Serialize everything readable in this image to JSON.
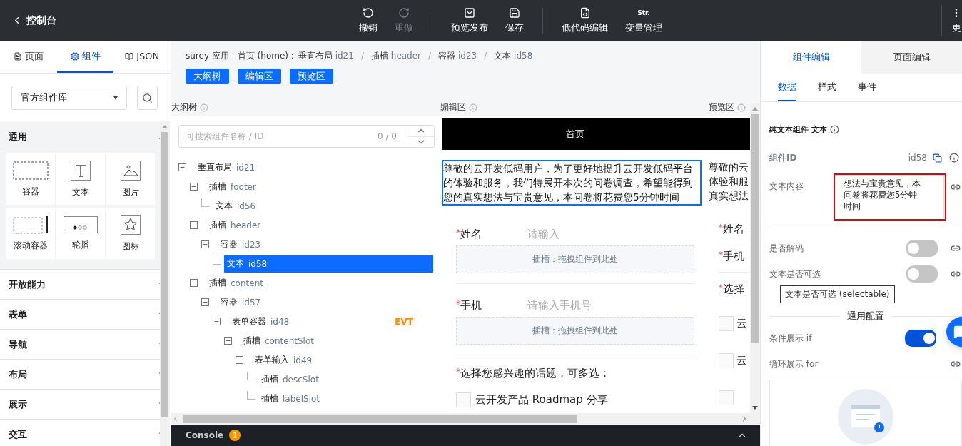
{
  "topbar": {
    "back": "控制台",
    "groups": [
      {
        "buttons": [
          {
            "label": "撤销",
            "kind": "undo",
            "disabled": false
          },
          {
            "label": "重做",
            "kind": "redo",
            "disabled": true
          }
        ]
      },
      {
        "buttons": [
          {
            "label": "预览发布",
            "kind": "preview",
            "disabled": false
          },
          {
            "label": "保存",
            "kind": "save",
            "disabled": false
          }
        ]
      },
      {
        "buttons": [
          {
            "label": "低代码编辑",
            "kind": "code",
            "disabled": false
          },
          {
            "label": "变量管理",
            "kind": "text",
            "icon_text": "Str.",
            "disabled": false
          }
        ]
      }
    ],
    "more": {
      "label": "更"
    }
  },
  "left_panel": {
    "tabs": [
      {
        "label": "页面",
        "kind": "page",
        "selected": false
      },
      {
        "label": "组件",
        "kind": "component",
        "selected": true
      },
      {
        "label": "JSON",
        "kind": "json",
        "selected": false
      }
    ],
    "library_select": "官方组件库",
    "categories": [
      {
        "label": "通用",
        "expanded": true,
        "items": [
          {
            "label": "容器",
            "kind": "container"
          },
          {
            "label": "文本",
            "kind": "text"
          },
          {
            "label": "图片",
            "kind": "image"
          },
          {
            "label": "滚动容器",
            "kind": "scroll"
          },
          {
            "label": "轮播",
            "kind": "carousel"
          },
          {
            "label": "图标",
            "kind": "icon"
          }
        ]
      },
      {
        "label": "开放能力",
        "expanded": false
      },
      {
        "label": "表单",
        "expanded": false
      },
      {
        "label": "导航",
        "expanded": false
      },
      {
        "label": "布局",
        "expanded": false
      },
      {
        "label": "展示",
        "expanded": false
      },
      {
        "label": "交互",
        "expanded": false
      }
    ]
  },
  "breadcrumb": {
    "app": "surey 应用 - 首页 (home) :",
    "segments": [
      {
        "name": "垂直布局",
        "id": "id21"
      },
      {
        "sep": "/",
        "name": "插槽",
        "id": "header"
      },
      {
        "sep": "/",
        "name": "容器",
        "id": "id23"
      },
      {
        "sep": "/",
        "name": "文本",
        "id": "id58"
      }
    ]
  },
  "view_buttons": [
    "大纲树",
    "编辑区",
    "预览区"
  ],
  "outline": {
    "title": "大纲树",
    "search_placeholder": "可搜索组件名称 / ID",
    "count": "0 / 0",
    "tree": [
      {
        "name": "垂直布局",
        "id": "id21",
        "expanded": true,
        "selected": false,
        "children": [
          {
            "name": "插槽",
            "id": "footer",
            "expanded": true,
            "selected": false,
            "children": [
              {
                "name": "文本",
                "id": "id56",
                "selected": false
              }
            ]
          },
          {
            "name": "插槽",
            "id": "header",
            "expanded": true,
            "selected": false,
            "children": [
              {
                "name": "容器",
                "id": "id23",
                "expanded": true,
                "selected": false,
                "children": [
                  {
                    "name": "文本",
                    "id": "id58",
                    "selected": true
                  }
                ]
              }
            ]
          },
          {
            "name": "插槽",
            "id": "content",
            "expanded": true,
            "selected": false,
            "children": [
              {
                "name": "容器",
                "id": "id57",
                "expanded": true,
                "selected": false,
                "children": [
                  {
                    "name": "表单容器",
                    "id": "id48",
                    "badge": "EVT",
                    "expanded": true,
                    "selected": false,
                    "children": [
                      {
                        "name": "插槽",
                        "id": "contentSlot",
                        "expanded": true,
                        "selected": false,
                        "children": [
                          {
                            "name": "表单输入",
                            "id": "id49",
                            "expanded": true,
                            "selected": false,
                            "children": [
                              {
                                "name": "插槽",
                                "id": "descSlot",
                                "selected": false
                              },
                              {
                                "name": "插槽",
                                "id": "labelSlot",
                                "selected": false
                              }
                            ]
                          }
                        ]
                      }
                    ]
                  }
                ]
              }
            ]
          }
        ]
      }
    ]
  },
  "editor": {
    "title": "编辑区",
    "header": "首页",
    "intro": "尊敬的云开发低码用户，为了更好地提升云开发低码平台的体验和服务，我们特展开本次的问卷调查，希望能得到您的真实想法与宝贵意见，本问卷将花费您5分钟时间",
    "fields": [
      {
        "mark": "*",
        "label": "姓名",
        "placeholder": "请输入",
        "slot": "插槽：拖拽组件到此处"
      },
      {
        "mark": "*",
        "label": "手机",
        "placeholder": "请输入手机号",
        "slot": "插槽：拖拽组件到此处"
      }
    ],
    "question": {
      "mark": "*",
      "label": "选择您感兴趣的话题，可多选：",
      "options": [
        {
          "label": "云开发产品 Roadmap 分享",
          "checked": false
        }
      ]
    }
  },
  "preview": {
    "title": "预览区",
    "intro_lines": [
      "尊敬的云",
      "体验和服",
      "真实想法"
    ],
    "fields": [
      {
        "mark": "*",
        "label": "姓名"
      },
      {
        "mark": "*",
        "label": "手机"
      }
    ],
    "question": {
      "mark": "*",
      "label": "选择",
      "options": [
        {
          "label": "云",
          "checked": false
        },
        {
          "label": "云",
          "checked": false
        },
        {
          "checked": false
        }
      ]
    }
  },
  "console": {
    "label": "Console",
    "badge": "1"
  },
  "properties": {
    "tabs": [
      {
        "label": "组件编辑",
        "selected": true
      },
      {
        "label": "页面编辑",
        "selected": false
      }
    ],
    "subtabs": [
      {
        "label": "数据",
        "selected": true
      },
      {
        "label": "样式",
        "selected": false
      },
      {
        "label": "事件",
        "selected": false
      }
    ],
    "title": "纯文本组件 文本",
    "component_id": {
      "label": "组件ID",
      "value": "id58"
    },
    "text_content": {
      "label": "文本内容",
      "value": "想法与宝贵意见，本问卷将花费您5分钟时间"
    },
    "switches": [
      {
        "label": "是否解码",
        "on": false
      },
      {
        "label": "文本是否可选",
        "on": false
      }
    ],
    "tooltip": "文本是否可选 (selectable)",
    "section": "通用配置",
    "condition": {
      "label": "条件展示 if",
      "on": true
    },
    "loop": {
      "label": "循环展示 for"
    }
  }
}
